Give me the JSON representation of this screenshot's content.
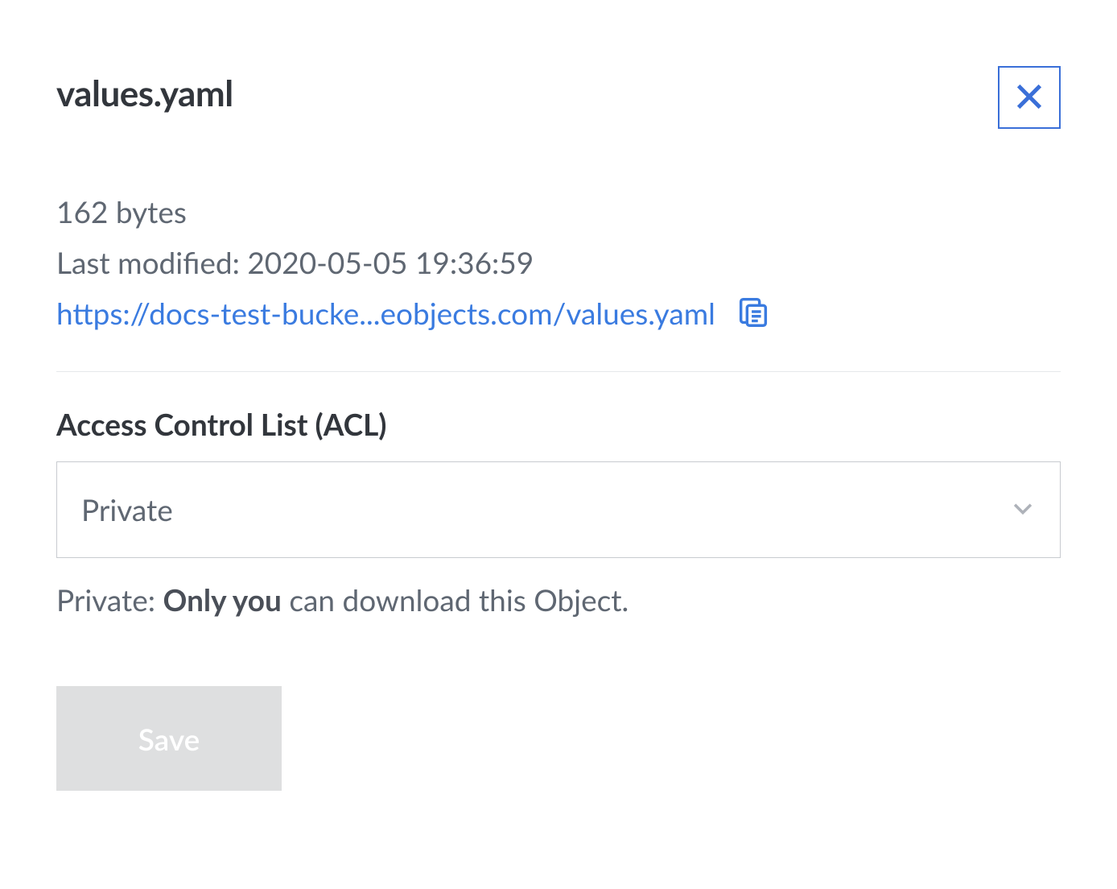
{
  "file": {
    "name": "values.yaml",
    "size": "162 bytes",
    "last_modified": "Last modified: 2020-05-05 19:36:59",
    "url": "https://docs-test-bucke...eobjects.com/values.yaml"
  },
  "acl": {
    "label": "Access Control List (ACL)",
    "selected": "Private",
    "help_prefix": "Private: ",
    "help_bold": "Only you",
    "help_suffix": " can download this Object."
  },
  "actions": {
    "save_label": "Save"
  }
}
